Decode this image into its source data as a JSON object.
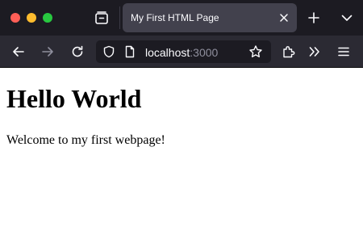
{
  "browser": {
    "tab": {
      "title": "My First HTML Page"
    },
    "address_bar": {
      "host": "localhost",
      "port": ":3000"
    },
    "icons": {
      "window_controls": [
        "close-dot",
        "minimize-dot",
        "zoom-dot"
      ],
      "tabstrip": [
        "tab-manager-icon",
        "close-icon",
        "plus-icon",
        "chevron-down-icon"
      ],
      "toolbar": [
        "back-arrow-icon",
        "forward-arrow-icon",
        "reload-icon",
        "shield-icon",
        "page-icon",
        "star-icon",
        "extensions-icon",
        "overflow-chevrons-icon",
        "hamburger-menu-icon"
      ]
    },
    "colors": {
      "tabstrip_bg": "#1c1b22",
      "selected_tab_bg": "#42414d",
      "toolbar_bg": "#2b2a33",
      "urlbar_bg": "#1c1b22",
      "close_dot": "#ff5f57",
      "minimize_dot": "#febc2e",
      "zoom_dot": "#28c840"
    }
  },
  "page": {
    "heading": "Hello World",
    "paragraph": "Welcome to my first webpage!"
  }
}
